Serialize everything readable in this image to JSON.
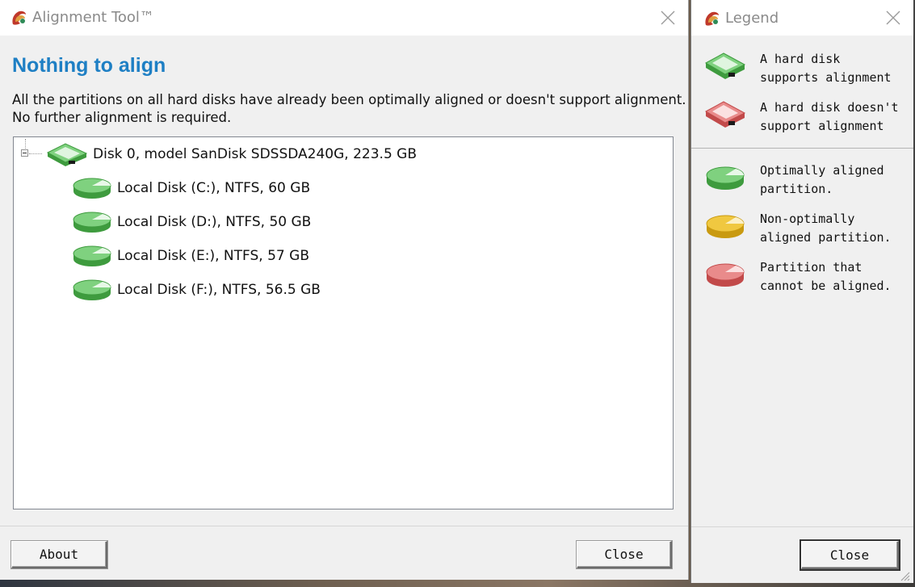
{
  "main_window": {
    "title": "Alignment Tool™",
    "headline": "Nothing to align",
    "description_lines": [
      "All the partitions on all hard disks have already been optimally aligned or doesn't support alignment.",
      "No further alignment is required."
    ],
    "tree": {
      "disk": {
        "label": "Disk 0, model SanDisk SDSSDA240G, 223.5 GB",
        "icon": "green-hard-disk-icon"
      },
      "partitions": [
        {
          "label": "Local Disk (C:), NTFS, 60 GB",
          "icon": "green-partition-icon"
        },
        {
          "label": "Local Disk (D:), NTFS, 50 GB",
          "icon": "green-partition-icon"
        },
        {
          "label": "Local Disk (E:), NTFS, 57 GB",
          "icon": "green-partition-icon"
        },
        {
          "label": "Local Disk (F:), NTFS, 56.5 GB",
          "icon": "green-partition-icon"
        }
      ]
    },
    "buttons": {
      "about": "About",
      "close": "Close"
    }
  },
  "legend_window": {
    "title": "Legend",
    "disk_items": [
      {
        "text": "A hard disk\nsupports alignment",
        "icon": "green-hard-disk-icon"
      },
      {
        "text": "A hard disk doesn't\nsupport alignment",
        "icon": "red-hard-disk-icon"
      }
    ],
    "partition_items": [
      {
        "text": "Optimally aligned\npartition.",
        "icon": "green-partition-icon"
      },
      {
        "text": "Non-optimally\naligned partition.",
        "icon": "yellow-partition-icon"
      },
      {
        "text": "Partition that\ncannot be aligned.",
        "icon": "red-partition-icon"
      }
    ],
    "buttons": {
      "close": "Close"
    }
  },
  "colors": {
    "headline": "#1e7fc4",
    "green": "#4caf50",
    "yellow": "#e0b21a",
    "red": "#d9534f"
  }
}
